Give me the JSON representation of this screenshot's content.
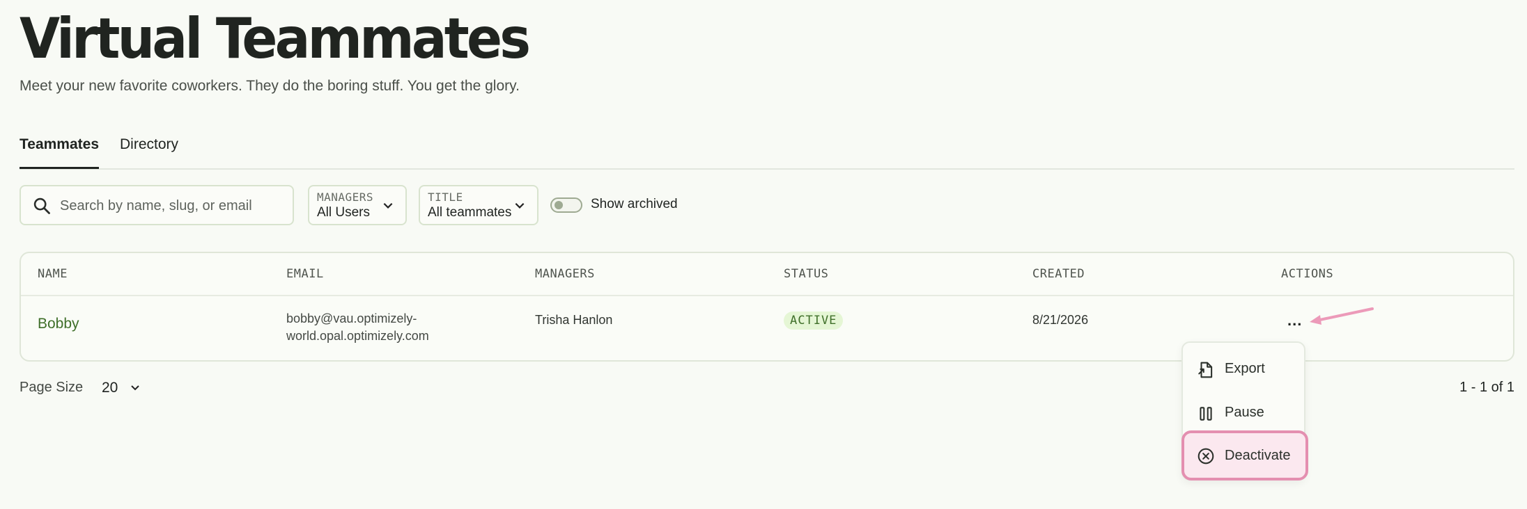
{
  "header": {
    "title": "Virtual Teammates",
    "subtitle": "Meet your new favorite coworkers. They do the boring stuff. You get the glory."
  },
  "tabs": [
    {
      "label": "Teammates",
      "active": true
    },
    {
      "label": "Directory",
      "active": false
    }
  ],
  "filters": {
    "search_placeholder": "Search by name, slug, or email",
    "managers": {
      "label": "MANAGERS",
      "value": "All Users"
    },
    "title": {
      "label": "TITLE",
      "value": "All teammates"
    },
    "show_archived": {
      "label": "Show archived",
      "on": false
    }
  },
  "table": {
    "columns": [
      "NAME",
      "EMAIL",
      "MANAGERS",
      "STATUS",
      "CREATED",
      "ACTIONS"
    ],
    "rows": [
      {
        "name": "Bobby",
        "email_line1": "bobby@vau.optimizely-",
        "email_line2": "world.opal.optimizely.com",
        "managers": "Trisha Hanlon",
        "status": "ACTIVE",
        "created": "8/21/2026",
        "actions": "..."
      }
    ]
  },
  "footer": {
    "page_size_label": "Page Size",
    "page_size": "20",
    "pagination": "1 - 1 of 1"
  },
  "actions_menu": {
    "items": [
      {
        "label": "Export",
        "icon": "export-file-icon"
      },
      {
        "label": "Pause",
        "icon": "pause-icon"
      },
      {
        "label": "Deactivate",
        "icon": "circle-x-icon",
        "highlighted": true
      }
    ]
  },
  "colors": {
    "background": "#f8faf5",
    "accent_green": "#3f6f2a",
    "badge_bg": "#e5f6d5",
    "highlight_border": "#e48fb0",
    "highlight_bg": "#fbe8ef",
    "annotation_arrow": "#ec9ab9"
  }
}
